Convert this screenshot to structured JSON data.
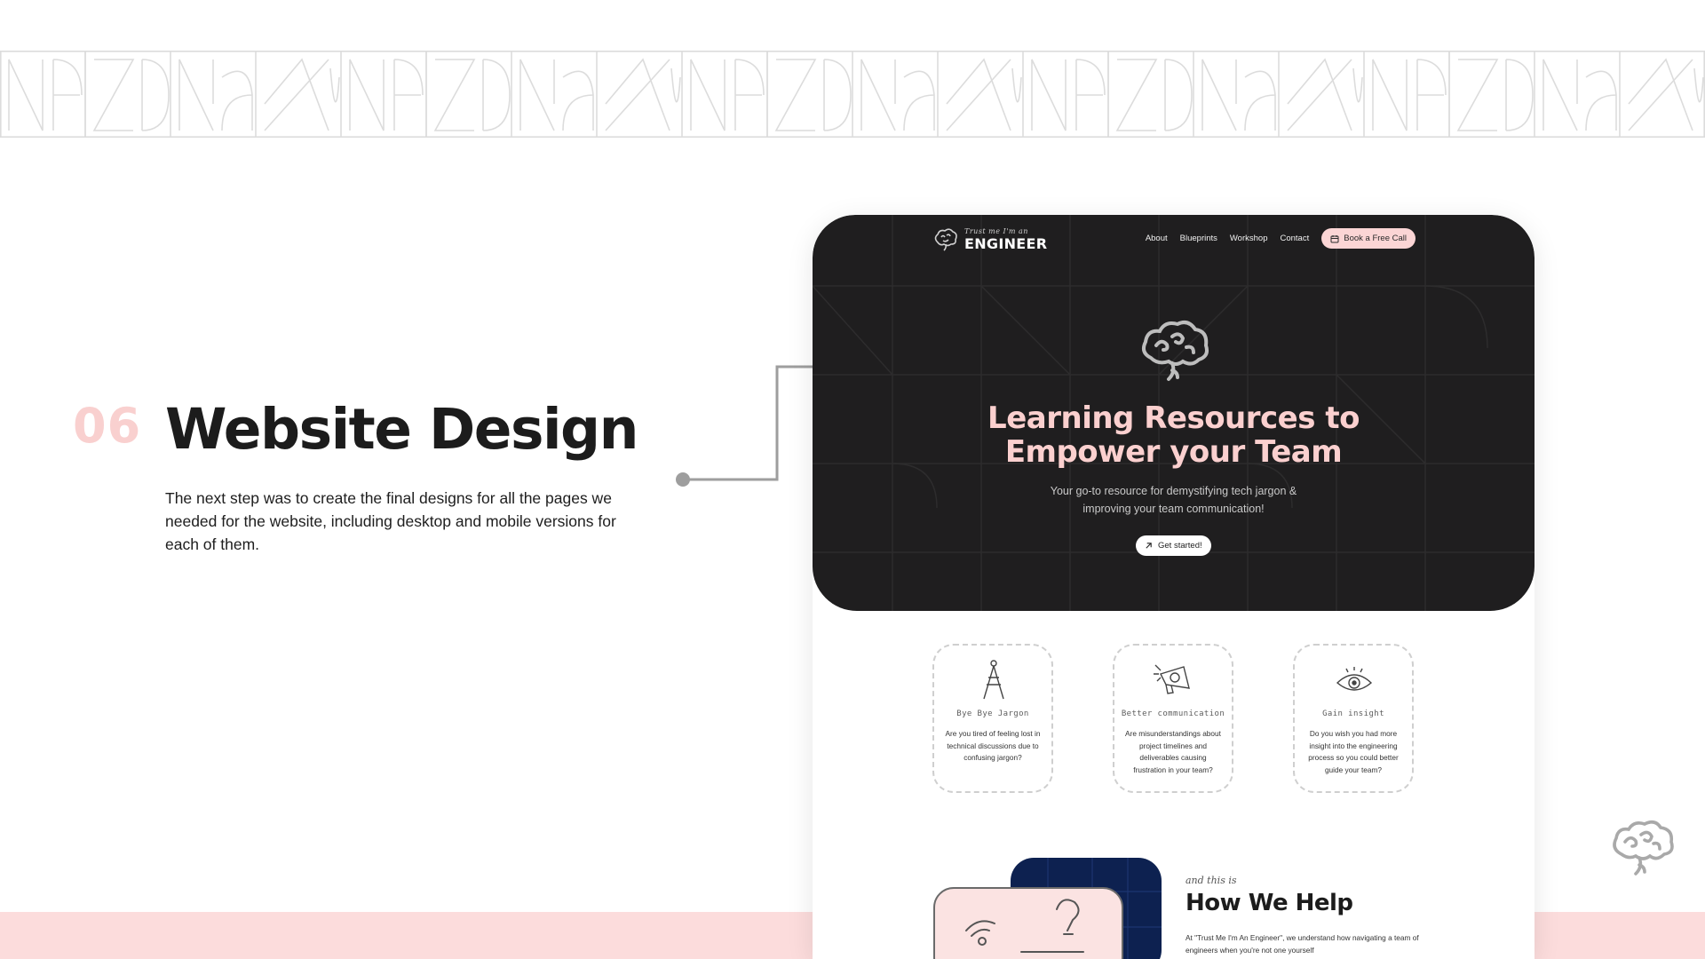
{
  "slide": {
    "number": "06",
    "title": "Website Design",
    "body": "The next step was to create the final designs for all the pages we needed for the website, including desktop and mobile versions for each of them."
  },
  "site": {
    "logo_tagline": "Trust me I'm an",
    "logo_word": "ENGINEER",
    "nav": [
      "About",
      "Blueprints",
      "Workshop",
      "Contact"
    ],
    "cta_label": "Book a Free Call",
    "hero_title_line1": "Learning Resources to",
    "hero_title_line2": "Empower your Team",
    "hero_sub_line1": "Your go-to resource for demystifying tech jargon &",
    "hero_sub_line2": "improving your team communication!",
    "hero_button": "Get started!",
    "cards": [
      {
        "icon": "compass-icon",
        "title": "Bye Bye Jargon",
        "text": "Are you tired of feeling lost in technical discussions due to confusing jargon?"
      },
      {
        "icon": "megaphone-icon",
        "title": "Better communication",
        "text": "Are misunderstandings about project timelines and deliverables causing frustration in your team?"
      },
      {
        "icon": "eye-icon",
        "title": "Gain insight",
        "text": "Do you wish you had more insight into the engineering process so you could better guide your team?"
      }
    ],
    "help_eyebrow": "and this is",
    "help_title": "How We Help",
    "help_body": "At \"Trust Me I'm An Engineer\", we understand how navigating a team of engineers when you're not one yourself"
  },
  "colors": {
    "accent_pink": "#fbd5d5",
    "number_pink": "#f9d0cf",
    "hero_bg": "#1f1e1f",
    "dark_navy": "#0d2150",
    "text_dark": "#1c1c1c"
  }
}
